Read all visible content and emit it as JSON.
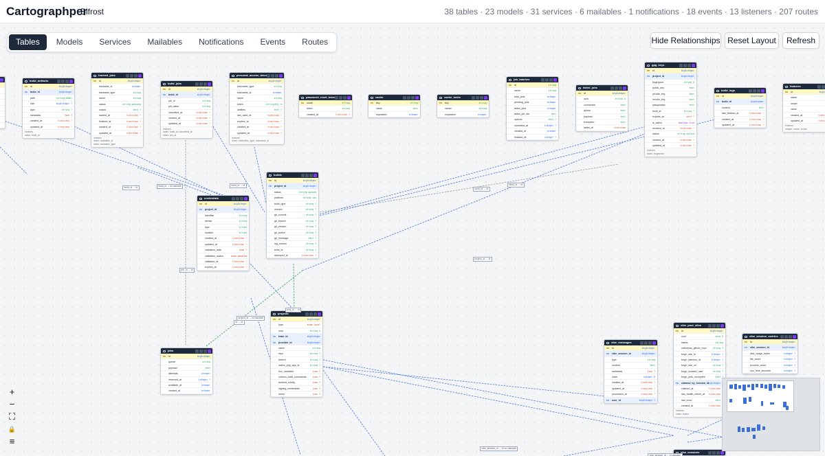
{
  "header": {
    "brand": "Cartographper",
    "project": "Bifrost",
    "stats": "38 tables · 23 models · 31 services · 6 mailables · 1 notifications · 18 events · 13 listeners · 207 routes"
  },
  "tabs": [
    {
      "label": "Tables",
      "active": true
    },
    {
      "label": "Models"
    },
    {
      "label": "Services"
    },
    {
      "label": "Mailables"
    },
    {
      "label": "Notifications"
    },
    {
      "label": "Events"
    },
    {
      "label": "Routes"
    }
  ],
  "toolbar": {
    "hide_relationships": "Hide Relationships",
    "reset_layout": "Reset Layout",
    "refresh": "Refresh"
  },
  "zoom_controls": [
    {
      "name": "zoom-in-button",
      "glyph": "+"
    },
    {
      "name": "zoom-out-button",
      "glyph": "−"
    },
    {
      "name": "fit-view-button",
      "glyph": "⛶"
    },
    {
      "name": "lock-button",
      "glyph": "🔒"
    },
    {
      "name": "menu-button",
      "glyph": "≡"
    }
  ],
  "colors": {
    "header": "#1e293b",
    "pk_bg": "#fef9c3",
    "fk_bg": "#e8f0fe",
    "edge_blue": "#5b83d6",
    "edge_green": "#4aa56a",
    "accent": "#7c3aed"
  },
  "tables": [
    {
      "id": "build_artifacts",
      "name": "build_artifacts",
      "cols": [
        [
          "PK",
          "id",
          "bigInteger"
        ],
        [
          "FK",
          "build_id",
          "bigInteger"
        ],
        [
          "",
          "path",
          "string(1000)"
        ],
        [
          "",
          "size",
          "bigInteger ?"
        ],
        [
          "",
          "type",
          "string ?"
        ],
        [
          "",
          "metadata",
          "json ?"
        ],
        [
          "",
          "created_at",
          "timestamp ?"
        ],
        [
          "",
          "updated_at",
          "timestamp ?"
        ]
      ],
      "indexes": [
        "index: build_id"
      ]
    },
    {
      "id": "tracked_jobs",
      "name": "tracked_jobs",
      "cols": [
        [
          "PK",
          "id",
          "bigInteger"
        ],
        [
          "",
          "trackable_id",
          "integer"
        ],
        [
          "",
          "trackable_type",
          "string"
        ],
        [
          "",
          "name",
          "string"
        ],
        [
          "",
          "status",
          "string pending"
        ],
        [
          "",
          "output",
          "text ?"
        ],
        [
          "",
          "started_at",
          "timestamp ?"
        ],
        [
          "",
          "finished_at",
          "timestamp ?"
        ],
        [
          "",
          "created_at",
          "timestamp ?"
        ],
        [
          "",
          "updated_at",
          "timestamp ?"
        ]
      ],
      "indexes": [
        "index: trackable_id",
        "index: trackable_type"
      ]
    },
    {
      "id": "build_jobs",
      "name": "build_jobs",
      "cols": [
        [
          "PK",
          "id",
          "bigInteger"
        ],
        [
          "FK",
          "build_id",
          "bigInteger"
        ],
        [
          "",
          "job_id",
          "string"
        ],
        [
          "",
          "job_class",
          "string"
        ],
        [
          "",
          "cancelled_at",
          "timestamp ?"
        ],
        [
          "",
          "created_at",
          "timestamp ?"
        ],
        [
          "",
          "updated_at",
          "timestamp ?"
        ]
      ],
      "indexes": [
        "index: build_id, cancelled_at",
        "index: job_id"
      ]
    },
    {
      "id": "personal_access_tokens",
      "name": "personal_access_tokens",
      "cols": [
        [
          "PK",
          "id",
          "bigInteger"
        ],
        [
          "",
          "tokenable_type",
          "string"
        ],
        [
          "",
          "tokenable_id",
          "integer"
        ],
        [
          "",
          "name",
          "string"
        ],
        [
          "",
          "token",
          "string(64) U"
        ],
        [
          "",
          "abilities",
          "text ?"
        ],
        [
          "",
          "last_used_at",
          "timestamp ?"
        ],
        [
          "",
          "expires_at",
          "timestamp ?"
        ],
        [
          "",
          "created_at",
          "timestamp ?"
        ],
        [
          "",
          "updated_at",
          "timestamp ?"
        ]
      ],
      "indexes": [
        "index: tokenable_type, tokenable_id"
      ]
    },
    {
      "id": "password_reset_tokens",
      "name": "password_reset_tokens",
      "cols": [
        [
          "PK",
          "email",
          "string"
        ],
        [
          "",
          "token",
          "string"
        ],
        [
          "",
          "created_at",
          "timestamp ?"
        ]
      ],
      "indexes": []
    },
    {
      "id": "cache",
      "name": "cache",
      "cols": [
        [
          "PK",
          "key",
          "string"
        ],
        [
          "",
          "value",
          "text"
        ],
        [
          "",
          "expiration",
          "integer"
        ]
      ],
      "indexes": []
    },
    {
      "id": "cache_locks",
      "name": "cache_locks",
      "cols": [
        [
          "PK",
          "key",
          "string"
        ],
        [
          "",
          "owner",
          "string"
        ],
        [
          "",
          "expiration",
          "integer"
        ]
      ],
      "indexes": []
    },
    {
      "id": "job_batches",
      "name": "job_batches",
      "cols": [
        [
          "PK",
          "id",
          "string"
        ],
        [
          "",
          "name",
          "string"
        ],
        [
          "",
          "total_jobs",
          "integer"
        ],
        [
          "",
          "pending_jobs",
          "integer"
        ],
        [
          "",
          "failed_jobs",
          "integer"
        ],
        [
          "",
          "failed_job_ids",
          "text"
        ],
        [
          "",
          "options",
          "text ?"
        ],
        [
          "",
          "cancelled_at",
          "integer ?"
        ],
        [
          "",
          "created_at",
          "integer"
        ],
        [
          "",
          "finished_at",
          "integer ?"
        ]
      ],
      "indexes": []
    },
    {
      "id": "failed_jobs",
      "name": "failed_jobs",
      "cols": [
        [
          "PK",
          "id",
          "bigInteger"
        ],
        [
          "",
          "uuid",
          "string U"
        ],
        [
          "",
          "connection",
          "text"
        ],
        [
          "",
          "queue",
          "text"
        ],
        [
          "",
          "payload",
          "text"
        ],
        [
          "",
          "exception",
          "text"
        ],
        [
          "",
          "failed_at",
          "timestamp"
        ]
      ],
      "indexes": []
    },
    {
      "id": "gpg_keys",
      "name": "gpg_keys",
      "cols": [
        [
          "PK",
          "id",
          "bigInteger"
        ],
        [
          "FK",
          "project_id",
          "bigInteger"
        ],
        [
          "",
          "fingerprint",
          "string U"
        ],
        [
          "",
          "public_key",
          "text"
        ],
        [
          "",
          "private_key",
          "text"
        ],
        [
          "",
          "revoke_key",
          "text"
        ],
        [
          "",
          "passphrase",
          "text"
        ],
        [
          "",
          "build_id",
          "string ?"
        ],
        [
          "",
          "expires_at",
          "date ?"
        ],
        [
          "",
          "is_active",
          "boolean true"
        ],
        [
          "",
          "revoked_at",
          "timestamp ?"
        ],
        [
          "",
          "status",
          "string active"
        ],
        [
          "",
          "created_at",
          "timestamp ?"
        ],
        [
          "",
          "updated_at",
          "timestamp ?"
        ]
      ],
      "indexes": [
        "index: fingerprint"
      ]
    },
    {
      "id": "build_logs",
      "name": "build_logs",
      "cols": [
        [
          "PK",
          "id",
          "bigInteger"
        ],
        [
          "FK",
          "build_id",
          "bigInteger"
        ],
        [
          "",
          "content",
          "text"
        ],
        [
          "",
          "last_fetched_at",
          "timestamp ?"
        ],
        [
          "",
          "created_at",
          "timestamp ?"
        ],
        [
          "",
          "updated_at",
          "timestamp ?"
        ]
      ],
      "indexes": []
    },
    {
      "id": "features",
      "name": "features",
      "cols": [
        [
          "PK",
          "id",
          "bigInteger"
        ],
        [
          "",
          "name",
          "string"
        ],
        [
          "",
          "scope",
          "string"
        ],
        [
          "",
          "value",
          "text"
        ],
        [
          "",
          "created_at",
          "timestamp ?"
        ],
        [
          "",
          "updated_at",
          "timestamp ?"
        ]
      ],
      "indexes": [
        "unique: name, scope"
      ]
    },
    {
      "id": "builds",
      "name": "builds",
      "cols": [
        [
          "PK",
          "id",
          "bigInteger"
        ],
        [
          "FK",
          "project_id",
          "bigInteger"
        ],
        [
          "",
          "status",
          "string queued"
        ],
        [
          "",
          "platform",
          "string ios"
        ],
        [
          "",
          "build_type",
          "string ?"
        ],
        [
          "",
          "version",
          "string ?"
        ],
        [
          "",
          "git_commit",
          "string ?"
        ],
        [
          "",
          "git_branch",
          "string ?"
        ],
        [
          "",
          "git_version",
          "string ?"
        ],
        [
          "",
          "git_author",
          "string ?"
        ],
        [
          "",
          "git_message",
          "text ?"
        ],
        [
          "",
          "log_stream",
          "string ?"
        ],
        [
          "",
          "build_id",
          "string ?"
        ],
        [
          "",
          "deployed_at",
          "timestamp ?"
        ]
      ],
      "indexes": []
    },
    {
      "id": "credentials",
      "name": "credentials",
      "cols": [
        [
          "PK",
          "id",
          "bigInteger"
        ],
        [
          "FK",
          "project_id",
          "bigInteger"
        ],
        [
          "",
          "identifier",
          "string"
        ],
        [
          "",
          "device",
          "string"
        ],
        [
          "",
          "type",
          "string"
        ],
        [
          "",
          "location",
          "string"
        ],
        [
          "",
          "created_at",
          "timestamp ?"
        ],
        [
          "",
          "updated_at",
          "timestamp ?"
        ],
        [
          "",
          "validation_date",
          "json ?"
        ],
        [
          "",
          "validation_status",
          "enum pending"
        ],
        [
          "",
          "validated_at",
          "timestamp ?"
        ],
        [
          "",
          "expires_at",
          "timestamp ?"
        ]
      ],
      "indexes": []
    },
    {
      "id": "projects",
      "name": "projects",
      "cols": [
        [
          "PK",
          "id",
          "bigInteger"
        ],
        [
          "",
          "type",
          "enum local"
        ],
        [
          "",
          "uuid",
          "string U"
        ],
        [
          "FK",
          "team_id",
          "bigInteger"
        ],
        [
          "FK",
          "provider_id",
          "bigInteger"
        ],
        [
          "",
          "name",
          "string"
        ],
        [
          "",
          "repo",
          "string ?"
        ],
        [
          "",
          "branch",
          "string ?"
        ],
        [
          "",
          "native_php_app_id",
          "string ?"
        ],
        [
          "",
          "env_variables",
          "json ?"
        ],
        [
          "",
          "custom_build_commands",
          "json ?"
        ],
        [
          "",
          "android_config",
          "json ?"
        ],
        [
          "",
          "signing_credentials",
          "json ?"
        ],
        [
          "",
          "menu",
          "json ?"
        ]
      ],
      "indexes": []
    },
    {
      "id": "jobs",
      "name": "jobs",
      "cols": [
        [
          "PK",
          "id",
          "bigInteger"
        ],
        [
          "",
          "queue",
          "string"
        ],
        [
          "",
          "payload",
          "text"
        ],
        [
          "",
          "attempts",
          "integer"
        ],
        [
          "",
          "reserved_at",
          "integer ?"
        ],
        [
          "",
          "available_at",
          "integer"
        ],
        [
          "",
          "created_at",
          "integer"
        ]
      ],
      "indexes": []
    },
    {
      "id": "vibe_messages",
      "name": "vibe_messages",
      "cols": [
        [
          "PK",
          "id",
          "bigInteger"
        ],
        [
          "FK",
          "vibe_session_id",
          "bigInteger"
        ],
        [
          "",
          "type",
          "string"
        ],
        [
          "",
          "content",
          "text"
        ],
        [
          "",
          "metadata",
          "json ?"
        ],
        [
          "",
          "order",
          "integer 0"
        ],
        [
          "",
          "created_at",
          "timestamp ?"
        ],
        [
          "",
          "updated_at",
          "timestamp ?"
        ],
        [
          "",
          "processed_at",
          "timestamp ?"
        ],
        [
          "FK",
          "user_id",
          "bigInteger ?"
        ]
      ],
      "indexes": []
    },
    {
      "id": "vibe_pool_sites",
      "name": "vibe_pool_sites",
      "cols": [
        [
          "PK",
          "id",
          "bigInteger"
        ],
        [
          "",
          "uuid",
          "uuid U"
        ],
        [
          "",
          "status",
          "string"
        ],
        [
          "",
          "nativephp_github_repo",
          "string ?"
        ],
        [
          "",
          "forge_site_id",
          "integer ?"
        ],
        [
          "",
          "forge_daemon_id",
          "integer ?"
        ],
        [
          "",
          "forge_site_url",
          "string ?"
        ],
        [
          "",
          "forge_isolated_user",
          "string ?"
        ],
        [
          "",
          "forge_pmk_encrypted",
          "text ?"
        ],
        [
          "FK",
          "claimed_by_session_id",
          "bigInteger ?"
        ],
        [
          "",
          "claimed_at",
          "timestamp ?"
        ],
        [
          "",
          "last_health_check_at",
          "timestamp ?"
        ],
        [
          "",
          "last_error",
          "text ?"
        ],
        [
          "",
          "created_at",
          "timestamp ?"
        ]
      ],
      "indexes": [
        "index: status"
      ]
    },
    {
      "id": "vibe_session_metrics",
      "name": "vibe_session_metrics",
      "cols": [
        [
          "PK",
          "id",
          "bigInteger"
        ],
        [
          "FK",
          "vibe_session_id",
          "bigInteger"
        ],
        [
          "",
          "disk_usage_bytes",
          "integer ?"
        ],
        [
          "",
          "file_count",
          "integer ?"
        ],
        [
          "",
          "process_count",
          "integer ?"
        ],
        [
          "",
          "cpu_time_seconds",
          "integer ?"
        ]
      ],
      "indexes": []
    },
    {
      "id": "vibe_sessions",
      "name": "vibe_sessions",
      "cols": [],
      "indexes": []
    },
    {
      "id": "partial_left",
      "name": "",
      "cols": [
        [
          "PK",
          "id",
          ""
        ],
        [
          "",
          "",
          ""
        ],
        [
          "",
          "",
          ""
        ],
        [
          "",
          "",
          ""
        ],
        [
          "",
          "",
          ""
        ],
        [
          "",
          "",
          ""
        ],
        [
          "",
          "",
          ""
        ],
        [
          "",
          "",
          ""
        ]
      ],
      "indexes": []
    }
  ],
  "edge_labels": {
    "build_artifacts": "build_id → id",
    "build_jobs": "build_id → id cascade",
    "pat": "build_id → id",
    "job_id": "job_id → id",
    "gpg": "build_id → id",
    "builds_projects": "project_id → id cascade",
    "cred": "project_id → id",
    "projects_builds": "proj_id → id",
    "cred_proj": "id → id",
    "vibe_msg": "vibe_session_id → id on cascade",
    "vibe_pool": "claimed_by_session_id → id on null",
    "vibe_session": "vibe_session_id → id cascade"
  }
}
